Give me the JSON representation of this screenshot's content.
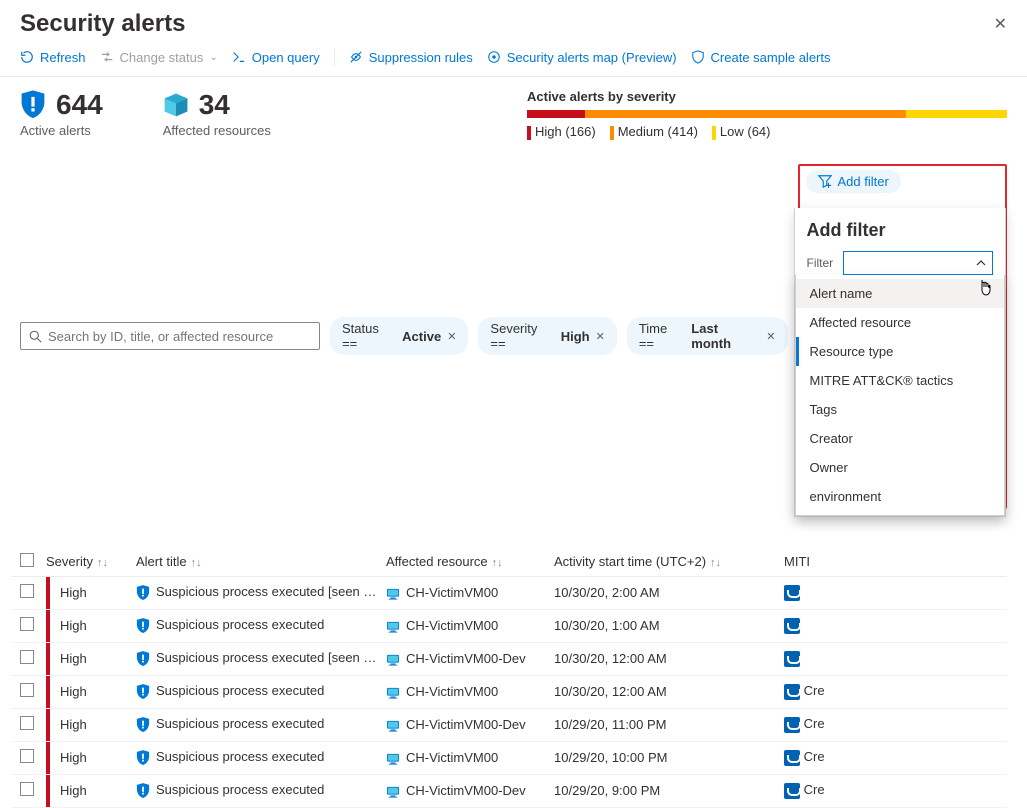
{
  "page": {
    "title": "Security alerts"
  },
  "toolbar": {
    "refresh": "Refresh",
    "change_status": "Change status",
    "open_query": "Open query",
    "suppression": "Suppression rules",
    "map": "Security alerts map (Preview)",
    "sample": "Create sample alerts"
  },
  "summary": {
    "active_count": "644",
    "active_label": "Active alerts",
    "affected_count": "34",
    "affected_label": "Affected resources",
    "sev_title": "Active alerts by severity",
    "high": {
      "label": "High (166)",
      "color": "#c50f1f",
      "width": "12%"
    },
    "medium": {
      "label": "Medium (414)",
      "color": "#ff8c00",
      "width": "67%"
    },
    "low": {
      "label": "Low (64)",
      "color": "#ffd700",
      "width": "21%"
    }
  },
  "search": {
    "placeholder": "Search by ID, title, or affected resource"
  },
  "pills": {
    "status": {
      "prefix": "Status == ",
      "value": "Active"
    },
    "severity": {
      "prefix": "Severity == ",
      "value": "High"
    },
    "time": {
      "prefix": "Time == ",
      "value": "Last month"
    }
  },
  "addfilter": {
    "button": "Add filter",
    "title": "Add filter",
    "label": "Filter",
    "options": {
      "o0": "Alert name",
      "o1": "Affected resource",
      "o2": "Resource type",
      "o3": "MITRE ATT&CK® tactics",
      "o4": "Tags",
      "o5": "Creator",
      "o6": "Owner",
      "o7": "environment"
    }
  },
  "columns": {
    "severity": "Severity",
    "title": "Alert title",
    "resource": "Affected resource",
    "time": "Activity start time (UTC+2)",
    "mitre": "MITI"
  },
  "rows": [
    {
      "sev": "High",
      "title": "Suspicious process executed [seen …",
      "res": "CH-VictimVM00",
      "time": "10/30/20, 2:00 AM",
      "mitre": ""
    },
    {
      "sev": "High",
      "title": "Suspicious process executed",
      "res": "CH-VictimVM00",
      "time": "10/30/20, 1:00 AM",
      "mitre": ""
    },
    {
      "sev": "High",
      "title": "Suspicious process executed [seen …",
      "res": "CH-VictimVM00-Dev",
      "time": "10/30/20, 12:00 AM",
      "mitre": ""
    },
    {
      "sev": "High",
      "title": "Suspicious process executed",
      "res": "CH-VictimVM00",
      "time": "10/30/20, 12:00 AM",
      "mitre": "Cre"
    },
    {
      "sev": "High",
      "title": "Suspicious process executed",
      "res": "CH-VictimVM00-Dev",
      "time": "10/29/20, 11:00 PM",
      "mitre": "Cre"
    },
    {
      "sev": "High",
      "title": "Suspicious process executed",
      "res": "CH-VictimVM00",
      "time": "10/29/20, 10:00 PM",
      "mitre": "Cre"
    },
    {
      "sev": "High",
      "title": "Suspicious process executed",
      "res": "CH-VictimVM00-Dev",
      "time": "10/29/20, 9:00 PM",
      "mitre": "Cre"
    }
  ]
}
